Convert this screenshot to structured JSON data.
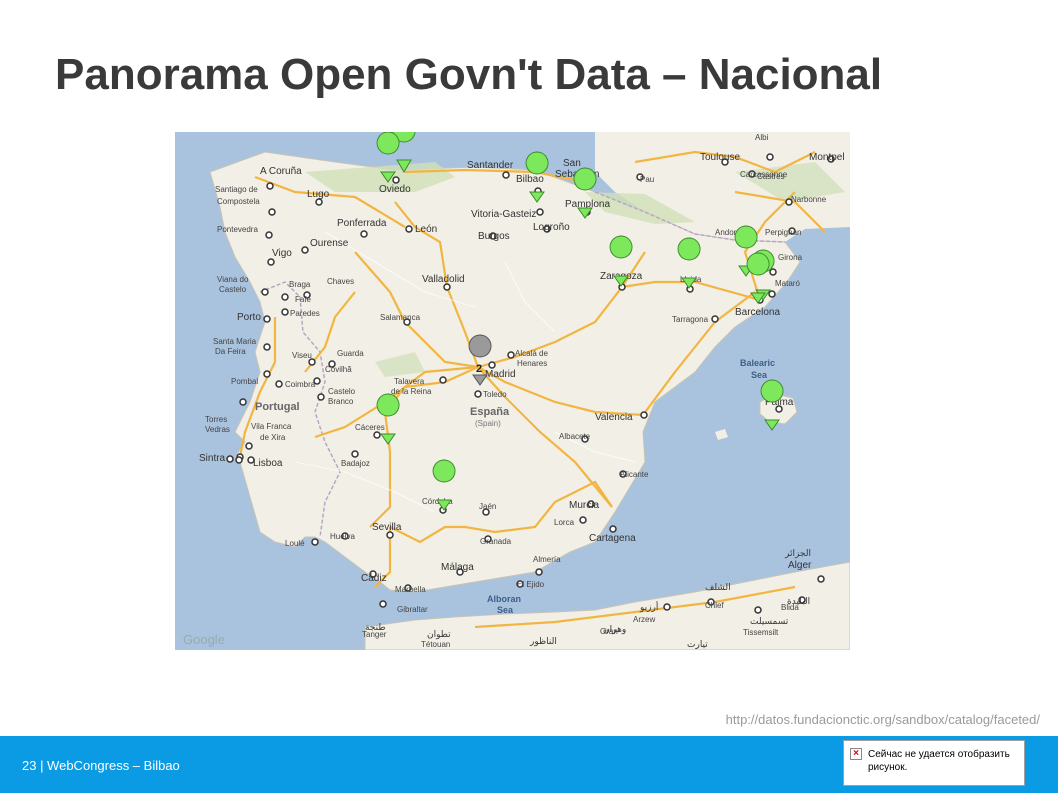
{
  "slide": {
    "title": "Panorama Open Govn't Data – Nacional",
    "source_url": "http://datos.fundacionctic.org/sandbox/catalog/faceted/"
  },
  "footer": {
    "text": "23 | WebCongress – Bilbao",
    "broken_image_message": "Сейчас не удается отобразить рисунок.",
    "bar_color": "#0b9be4"
  },
  "map": {
    "attribution": "Google",
    "colors": {
      "sea": "#a9c3df",
      "land": "#f2efe6",
      "green_area": "#cfe0b8",
      "road": "#f2b541",
      "marker_green": "#7ee85c",
      "marker_gray": "#9a9a9a"
    },
    "cluster_marker": {
      "count": "2",
      "city": "Madrid"
    },
    "countries": [
      {
        "name": "España"
      },
      {
        "name": "(Spain)"
      },
      {
        "name": "Portugal"
      },
      {
        "name": "Andorra"
      }
    ],
    "seas": [
      "Balearic",
      "Sea",
      "Alboran",
      "Sea"
    ],
    "cities": [
      "Oviedo",
      "Santander",
      "Bilbao",
      "San",
      "Sebastián",
      "Vitoria-Gasteiz",
      "Pamplona",
      "Logroño",
      "A Coruña",
      "Lugo",
      "Santiago de",
      "Compostela",
      "Ponferrada",
      "León",
      "Burgos",
      "Pontevedra",
      "Vigo",
      "Ourense",
      "Viana do",
      "Castelo",
      "Braga",
      "Chaves",
      "Fafe",
      "Paredes",
      "Porto",
      "Santa Maria",
      "Da Feira",
      "Viseu",
      "Guarda",
      "Covilhã",
      "Coimbra",
      "Castelo",
      "Branco",
      "Pombal",
      "Torres",
      "Vedras",
      "Vila Franca",
      "de Xira",
      "Sintra",
      "Lisboa",
      "Valladolid",
      "Salamanca",
      "Talavera",
      "de la Reina",
      "Toledo",
      "Madrid",
      "Alcalá de",
      "Henares",
      "Cáceres",
      "Badajoz",
      "Albacete",
      "Valencia",
      "Alicante",
      "Murcia",
      "Lorca",
      "Cartagena",
      "Córdoba",
      "Jaén",
      "Sevilla",
      "Huelva",
      "Loulé",
      "Cádiz",
      "Marbella",
      "Málaga",
      "Granada",
      "Almería",
      "El Ejido",
      "Gibraltar",
      "Tanger",
      "Tétouan",
      "Zaragoza",
      "Lleida",
      "Tarragona",
      "Barcelona",
      "Mataró",
      "Girona",
      "Perpignan",
      "Palma",
      "Toulouse",
      "Pau",
      "Carcassonne",
      "Castres",
      "Albi",
      "Narbonne",
      "Montpel",
      "Alger",
      "Blida",
      "Chlef",
      "Arzew",
      "Tissemsilt",
      "Oran"
    ],
    "arabic_labels": [
      "طنجة",
      "تطوان",
      "الناظور",
      "أرزيو",
      "وهران",
      "الشلف",
      "تسمسيلت",
      "البليدة",
      "الجزائر",
      "تيارت"
    ]
  }
}
